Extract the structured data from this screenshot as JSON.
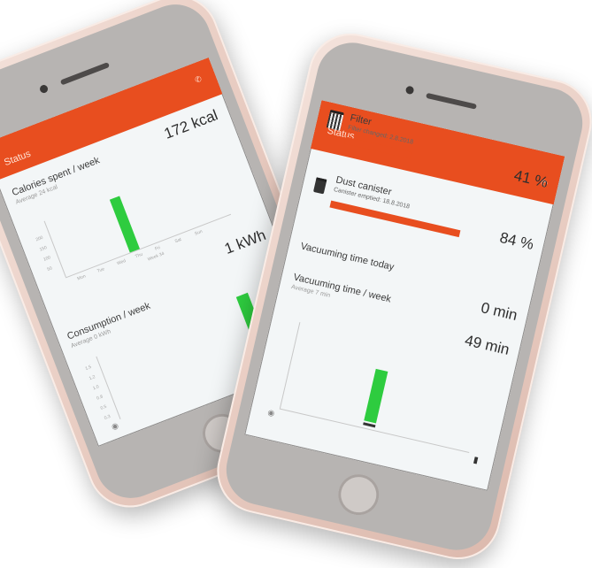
{
  "left_phone": {
    "header_title": "Status",
    "calories_value": "172 kcal",
    "calories_title": "Calories spent / week",
    "calories_subtitle": "Average 24 kcal",
    "chart1_days": [
      "Mon",
      "Tue",
      "Wed",
      "Thu",
      "Fri",
      "Sat",
      "Sun"
    ],
    "chart1_ymarks": [
      "200",
      "150",
      "100",
      "50"
    ],
    "chart1_xlabel": "Week 34",
    "energy_value": "1 kWh",
    "consumption_title": "Consumption / week",
    "consumption_subtitle": "Average 0 kWh",
    "chart2_ymarks": [
      "1.5",
      "1.2",
      "1.0",
      "0.8",
      "0.5",
      "0.3"
    ]
  },
  "right_phone": {
    "header_title": "Status",
    "filter_title": "Filter",
    "filter_sub": "Filter changed: 2.8.2018",
    "filter_percent": "41 %",
    "filter_level": 0.41,
    "dust_title": "Dust canister",
    "dust_sub": "Canister emptied: 18.8.2018",
    "dust_percent": "84 %",
    "dust_level": 0.84,
    "vac_today_label": "Vacuuming time today",
    "vac_today_value": "0 min",
    "vac_week_label": "Vacuuming time / week",
    "vac_week_sub": "Average 7 min",
    "vac_week_value": "49 min"
  },
  "colors": {
    "accent": "#e84e1f",
    "bar": "#2ecc3f",
    "screen_bg": "#f3f6f7"
  },
  "icons": {
    "filter": "filter-cartridge-icon",
    "dust": "trash-bin-icon",
    "phone": "phone-icon",
    "robot": "robot-vacuum-icon"
  }
}
